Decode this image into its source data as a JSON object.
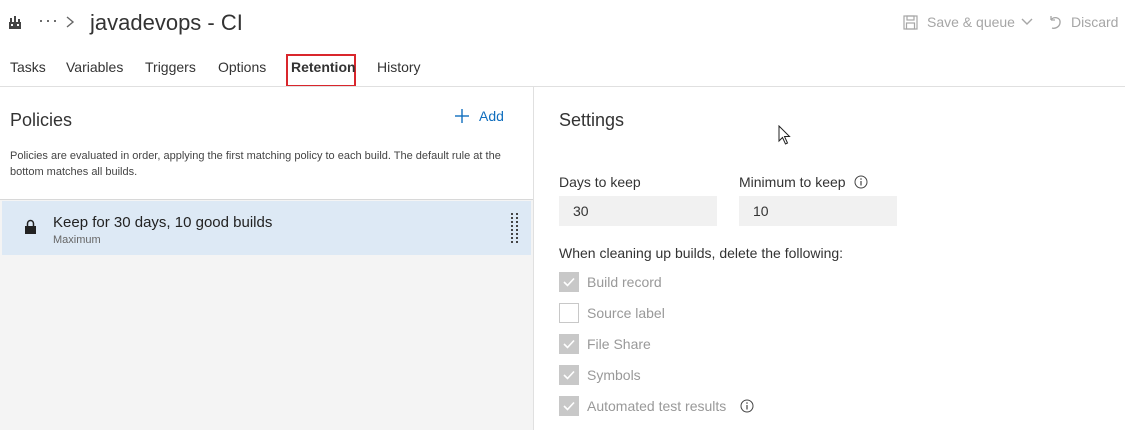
{
  "header": {
    "ellipsis": "···",
    "title": "javadevops - CI",
    "save_queue_label": "Save & queue",
    "discard_label": "Discard"
  },
  "tabs": [
    {
      "label": "Tasks",
      "active": false
    },
    {
      "label": "Variables",
      "active": false
    },
    {
      "label": "Triggers",
      "active": false
    },
    {
      "label": "Options",
      "active": false
    },
    {
      "label": "Retention",
      "active": true
    },
    {
      "label": "History",
      "active": false
    }
  ],
  "policies": {
    "title": "Policies",
    "add_label": "Add",
    "description": "Policies are evaluated in order, applying the first matching policy to each build. The default rule at the bottom matches all builds.",
    "items": [
      {
        "name": "Keep for 30 days, 10 good builds",
        "subtitle": "Maximum",
        "locked": true
      }
    ]
  },
  "settings": {
    "title": "Settings",
    "days_to_keep_label": "Days to keep",
    "days_to_keep_value": "30",
    "minimum_to_keep_label": "Minimum to keep",
    "minimum_to_keep_value": "10",
    "cleanup_label": "When cleaning up builds, delete the following:",
    "cleanup_options": [
      {
        "label": "Build record",
        "checked": true
      },
      {
        "label": "Source label",
        "checked": false
      },
      {
        "label": "File Share",
        "checked": true
      },
      {
        "label": "Symbols",
        "checked": true
      },
      {
        "label": "Automated test results",
        "checked": true
      }
    ]
  },
  "colors": {
    "accent": "#106ebe",
    "selected_row": "#dde9f5",
    "highlight_box": "#d9262c",
    "disabled_text": "#a6a6a6"
  },
  "icons": [
    "build-pipeline-icon",
    "chevron-right-icon",
    "save-icon",
    "chevron-down-icon",
    "undo-icon",
    "plus-icon",
    "lock-icon",
    "drag-grip-icon",
    "info-icon",
    "checkmark-icon",
    "mouse-cursor-icon"
  ]
}
